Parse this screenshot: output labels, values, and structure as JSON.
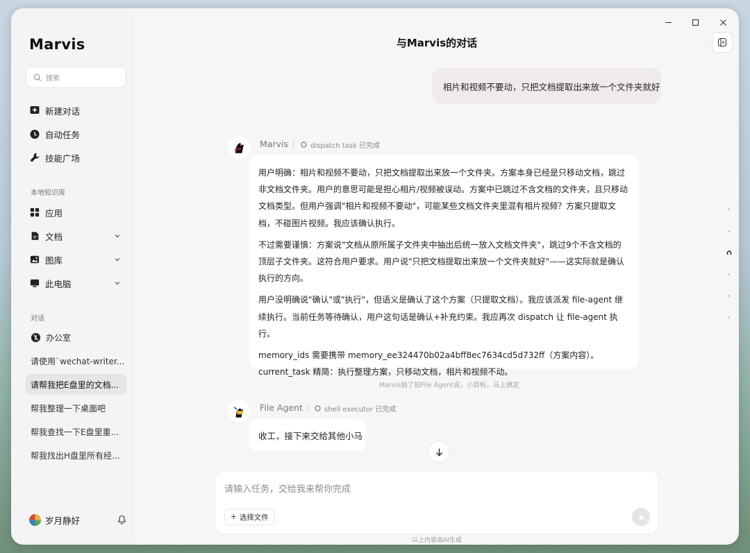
{
  "app": {
    "name": "Marvis"
  },
  "sidebar": {
    "search_placeholder": "搜索",
    "nav": [
      {
        "label": "新建对话",
        "icon": "new-chat-icon"
      },
      {
        "label": "自动任务",
        "icon": "clock-icon"
      },
      {
        "label": "技能广场",
        "icon": "wrench-icon"
      }
    ],
    "library_title": "本地知识库",
    "library": [
      {
        "label": "应用",
        "icon": "grid-icon"
      },
      {
        "label": "文档",
        "icon": "document-icon"
      },
      {
        "label": "图库",
        "icon": "image-icon"
      },
      {
        "label": "此电脑",
        "icon": "monitor-icon"
      }
    ],
    "conversations_title": "对话",
    "conversations": [
      {
        "label": "办公室",
        "icon": "office-icon"
      },
      {
        "label": "请使用`wechat-writer..."
      },
      {
        "label": "请帮我把E盘里的文档..."
      },
      {
        "label": "帮我整理一下桌面吧"
      },
      {
        "label": "帮我查找一下E盘里重..."
      },
      {
        "label": "帮我找出H盘里所有经..."
      }
    ],
    "user_name": "岁月静好"
  },
  "header": {
    "title": "与Marvis的对话"
  },
  "messages": {
    "user_message": "相片和视频不要动，只把文档提取出来放一个文件夹就好",
    "marvis": {
      "name": "Marvis",
      "status": "dispatch task 已完成",
      "paragraphs": [
        "用户明确：相片和视频不要动，只把文档提取出来放一个文件夹。方案本身已经是只移动文档，跳过非文档文件夹。用户的意思可能是担心相片/视频被误动。方案中已跳过不含文档的文件夹，且只移动文档类型。但用户强调\"相片和视频不要动\"，可能某些文档文件夹里混有相片视频？方案只提取文档，不碰图片视频。我应该确认执行。",
        "不过需要谨慎：方案说\"文档从原所属子文件夹中抽出后统一放入文档文件夹\"，跳过9个不含文档的顶层子文件夹。这符合用户要求。用户说\"只把文档提取出来放一个文件夹就好\"——这实际就是确认执行的方向。",
        "用户没明确说\"确认\"或\"执行\"，但语义是确认了这个方案（只提取文档）。我应该派发 file-agent 继续执行。当前任务等待确认，用户这句话是确认+补充约束。我应再次 dispatch 让 file-agent 执行。",
        "memory_ids 需要携带 memory_ee324470b02a4bff8ec7634cd5d732ff（方案内容）。current_task 精简：执行整理方案，只移动文档，相片和视频不动。"
      ]
    },
    "system_note": "Marvis拍了拍File Agent说，小目标，马上搞定",
    "file_agent": {
      "name": "File Agent",
      "status": "shell executor 已完成",
      "text": "收工，接下来交给其他小马"
    }
  },
  "composer": {
    "placeholder": "请输入任务，交给我来帮你完成",
    "attach_label": "选择文件"
  },
  "footer_note": "以上内容由AI生成"
}
